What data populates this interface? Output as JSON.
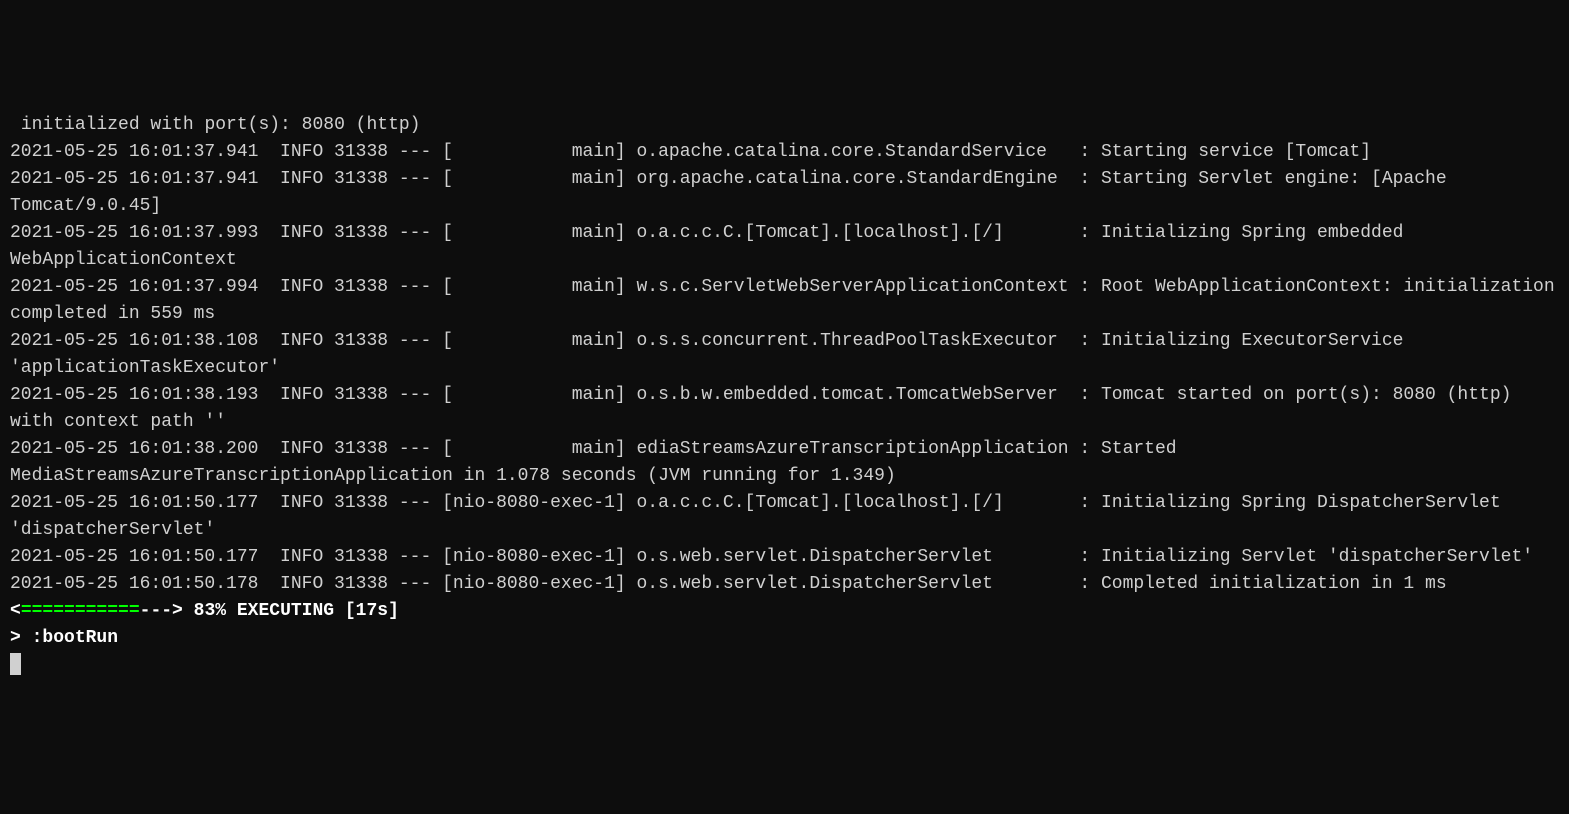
{
  "logs": {
    "line0": " initialized with port(s): 8080 (http)",
    "line1": "2021-05-25 16:01:37.941  INFO 31338 --- [           main] o.apache.catalina.core.StandardService   : Starting service [Tomcat]",
    "line2": "2021-05-25 16:01:37.941  INFO 31338 --- [           main] org.apache.catalina.core.StandardEngine  : Starting Servlet engine: [Apache Tomcat/9.0.45]",
    "line3": "2021-05-25 16:01:37.993  INFO 31338 --- [           main] o.a.c.c.C.[Tomcat].[localhost].[/]       : Initializing Spring embedded WebApplicationContext",
    "line4": "2021-05-25 16:01:37.994  INFO 31338 --- [           main] w.s.c.ServletWebServerApplicationContext : Root WebApplicationContext: initialization completed in 559 ms",
    "line5": "2021-05-25 16:01:38.108  INFO 31338 --- [           main] o.s.s.concurrent.ThreadPoolTaskExecutor  : Initializing ExecutorService 'applicationTaskExecutor'",
    "line6": "2021-05-25 16:01:38.193  INFO 31338 --- [           main] o.s.b.w.embedded.tomcat.TomcatWebServer  : Tomcat started on port(s): 8080 (http) with context path ''",
    "line7": "2021-05-25 16:01:38.200  INFO 31338 --- [           main] ediaStreamsAzureTranscriptionApplication : Started MediaStreamsAzureTranscriptionApplication in 1.078 seconds (JVM running for 1.349)",
    "line8": "2021-05-25 16:01:50.177  INFO 31338 --- [nio-8080-exec-1] o.a.c.c.C.[Tomcat].[localhost].[/]       : Initializing Spring DispatcherServlet 'dispatcherServlet'",
    "line9": "2021-05-25 16:01:50.177  INFO 31338 --- [nio-8080-exec-1] o.s.web.servlet.DispatcherServlet        : Initializing Servlet 'dispatcherServlet'",
    "line10": "2021-05-25 16:01:50.178  INFO 31338 --- [nio-8080-exec-1] o.s.web.servlet.DispatcherServlet        : Completed initialization in 1 ms"
  },
  "progress": {
    "bar_start": "<",
    "bar_filled": "===========",
    "bar_empty": "---> ",
    "percent_text": "83% EXECUTING [17s]"
  },
  "task": {
    "prompt": "> ",
    "name": ":bootRun"
  }
}
